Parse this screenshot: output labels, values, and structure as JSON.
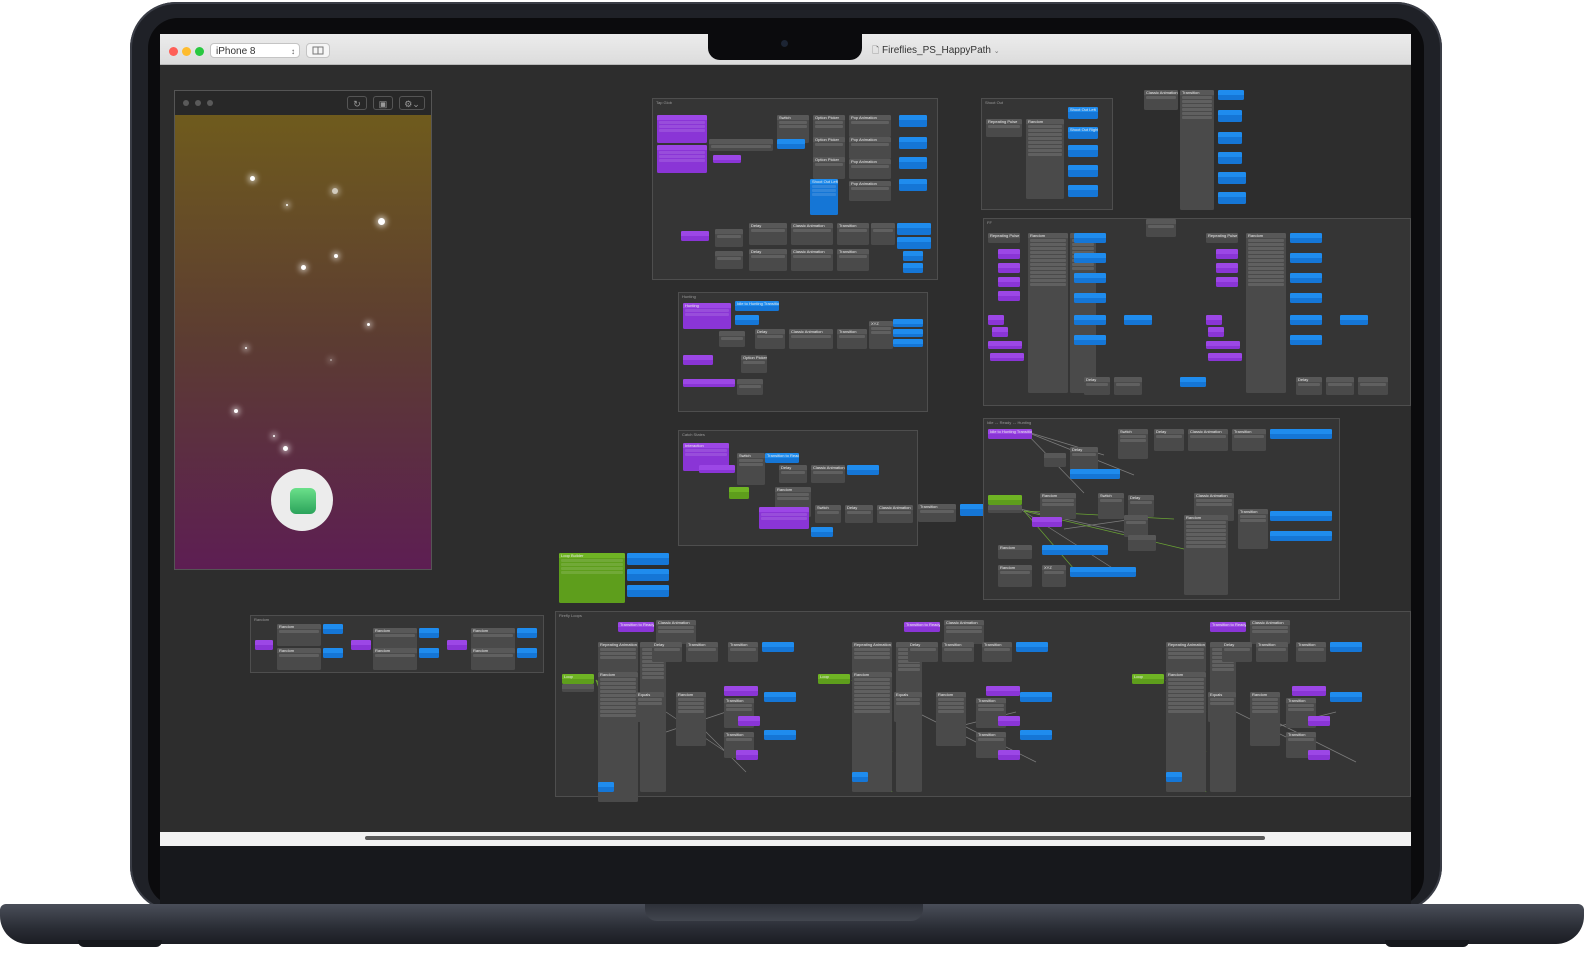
{
  "window": {
    "device_selector": "iPhone 8",
    "document_title": "Fireflies_PS_HappyPath",
    "traffic_lights": {
      "close": "#fe5f57",
      "minimize": "#febc2e",
      "zoom": "#28c840"
    }
  },
  "preview": {
    "toolbar_icons": [
      "refresh-icon",
      "record-icon",
      "settings-icon"
    ],
    "gradient_top": "#6f5b1d",
    "gradient_bottom": "#5d1e53"
  },
  "colors": {
    "patch_gray": "#4a4a4a",
    "patch_purple": "#8a35d6",
    "patch_blue": "#1576d6",
    "patch_green": "#5e9e1c",
    "canvas": "#2d2d2d"
  },
  "patch_labels": {
    "switch": "Switch",
    "option_picker": "Option Picker",
    "pop_animation": "Pop Animation",
    "delay": "Delay",
    "classic_animation": "Classic Animation",
    "transition": "Transition",
    "random": "Random",
    "repeating_pulse": "Repeating Pulse",
    "repeating_animation": "Repeating Animation",
    "interaction": "Interaction",
    "loop_builder": "Loop Builder",
    "loop": "Loop",
    "equals": "Equals",
    "hit_area": "Hit Area",
    "shoot_out_left": "Shoot Out Left",
    "shoot_out_right": "Shoot Out Right",
    "idle_to_hunting": "Idle to Hunting Transition",
    "transition_to_ready": "Transition to Ready",
    "hunting": "Hunting",
    "xy_pos": "XYZ",
    "random_label": "Random"
  }
}
